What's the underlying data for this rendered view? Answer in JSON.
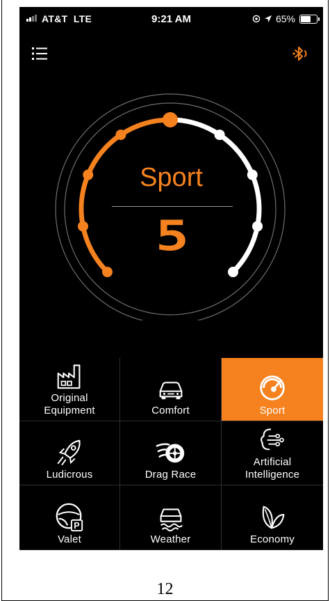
{
  "status_bar": {
    "carrier": "AT&T  LTE",
    "time": "9:21 AM",
    "battery_text": "65%",
    "battery_level": 0.65
  },
  "header": {
    "menu_icon": "list-icon",
    "bluetooth_icon": "bluetooth-icon"
  },
  "gauge": {
    "mode_title": "Sport",
    "mode_number": "5",
    "total_steps": 9,
    "active_step": 5,
    "active_color": "#f5821f",
    "inactive_color": "#ffffff"
  },
  "modes": [
    {
      "label": "Original\nEquipment",
      "icon": "factory-icon",
      "active": false
    },
    {
      "label": "Comfort",
      "icon": "car-icon",
      "active": false
    },
    {
      "label": "Sport",
      "icon": "speedometer-icon",
      "active": true
    },
    {
      "label": "Ludicrous",
      "icon": "rocket-icon",
      "active": false
    },
    {
      "label": "Drag Race",
      "icon": "flaming-wheel-icon",
      "active": false
    },
    {
      "label": "Artificial\nIntelligence",
      "icon": "ai-brain-icon",
      "active": false
    },
    {
      "label": "Valet",
      "icon": "steering-wheel-parking-icon",
      "active": false
    },
    {
      "label": "Weather",
      "icon": "car-weather-icon",
      "active": false
    },
    {
      "label": "Economy",
      "icon": "leaf-icon",
      "active": false
    }
  ],
  "page_number": "12"
}
